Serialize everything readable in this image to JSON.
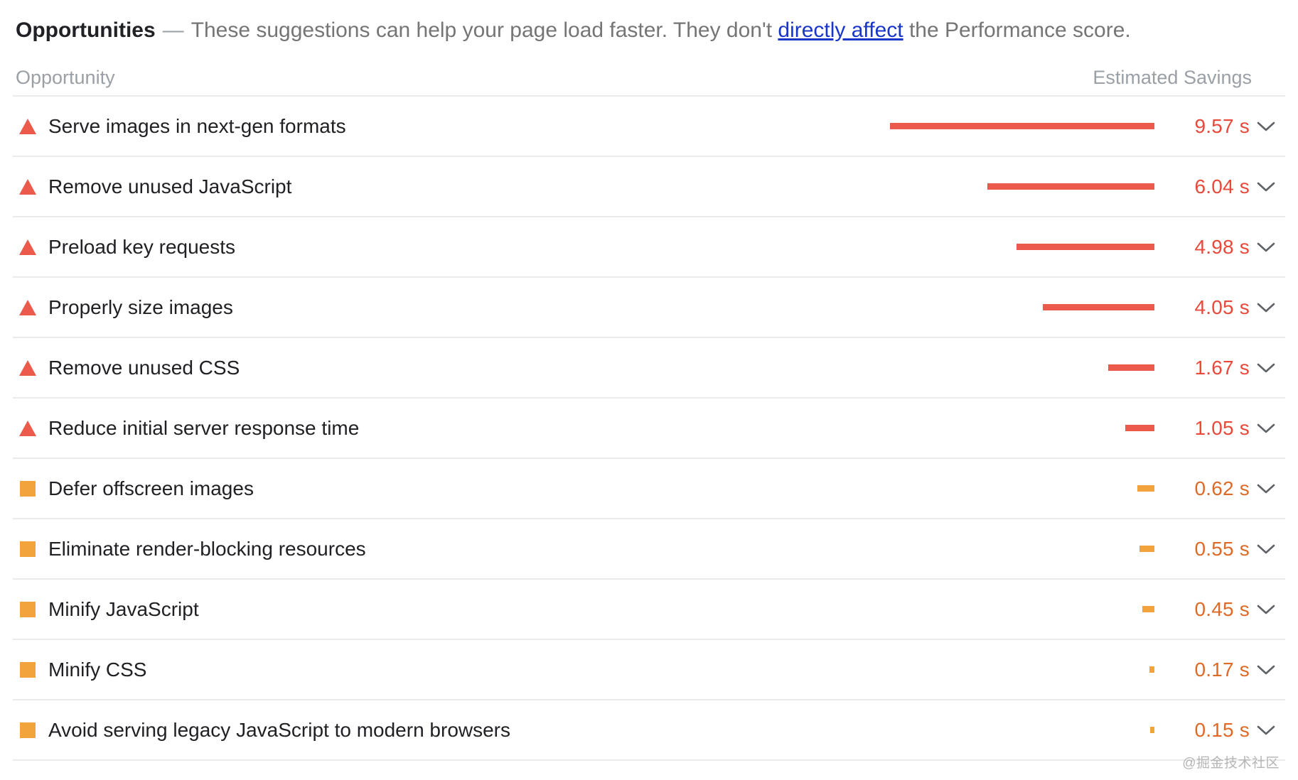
{
  "header": {
    "title": "Opportunities",
    "dash": "—",
    "desc_before": "These suggestions can help your page load faster. They don't",
    "link_text": "directly affect",
    "desc_after": "the Performance score."
  },
  "table": {
    "columns": {
      "opportunity": "Opportunity",
      "savings": "Estimated Savings"
    },
    "rows": [
      {
        "severity": "error",
        "icon": "triangle-warning-icon",
        "label": "Serve images in next-gen formats",
        "savings": "9.57 s",
        "seconds": 9.57,
        "expand_icon": "chevron-down-icon"
      },
      {
        "severity": "error",
        "icon": "triangle-warning-icon",
        "label": "Remove unused JavaScript",
        "savings": "6.04 s",
        "seconds": 6.04,
        "expand_icon": "chevron-down-icon"
      },
      {
        "severity": "error",
        "icon": "triangle-warning-icon",
        "label": "Preload key requests",
        "savings": "4.98 s",
        "seconds": 4.98,
        "expand_icon": "chevron-down-icon"
      },
      {
        "severity": "error",
        "icon": "triangle-warning-icon",
        "label": "Properly size images",
        "savings": "4.05 s",
        "seconds": 4.05,
        "expand_icon": "chevron-down-icon"
      },
      {
        "severity": "error",
        "icon": "triangle-warning-icon",
        "label": "Remove unused CSS",
        "savings": "1.67 s",
        "seconds": 1.67,
        "expand_icon": "chevron-down-icon"
      },
      {
        "severity": "error",
        "icon": "triangle-warning-icon",
        "label": "Reduce initial server response time",
        "savings": "1.05 s",
        "seconds": 1.05,
        "expand_icon": "chevron-down-icon"
      },
      {
        "severity": "average",
        "icon": "square-warning-icon",
        "label": "Defer offscreen images",
        "savings": "0.62 s",
        "seconds": 0.62,
        "expand_icon": "chevron-down-icon"
      },
      {
        "severity": "average",
        "icon": "square-warning-icon",
        "label": "Eliminate render-blocking resources",
        "savings": "0.55 s",
        "seconds": 0.55,
        "expand_icon": "chevron-down-icon"
      },
      {
        "severity": "average",
        "icon": "square-warning-icon",
        "label": "Minify JavaScript",
        "savings": "0.45 s",
        "seconds": 0.45,
        "expand_icon": "chevron-down-icon"
      },
      {
        "severity": "average",
        "icon": "square-warning-icon",
        "label": "Minify CSS",
        "savings": "0.17 s",
        "seconds": 0.17,
        "expand_icon": "chevron-down-icon"
      },
      {
        "severity": "average",
        "icon": "square-warning-icon",
        "label": "Avoid serving legacy JavaScript to modern browsers",
        "savings": "0.15 s",
        "seconds": 0.15,
        "expand_icon": "chevron-down-icon"
      }
    ]
  },
  "chart_data": {
    "type": "bar",
    "title": "Opportunities — Estimated Savings",
    "xlabel": "Estimated Savings (s)",
    "ylabel": "Opportunity",
    "xlim": [
      0,
      9.57
    ],
    "grid": false,
    "legend": null,
    "orientation": "horizontal",
    "categories": [
      "Serve images in next-gen formats",
      "Remove unused JavaScript",
      "Preload key requests",
      "Properly size images",
      "Remove unused CSS",
      "Reduce initial server response time",
      "Defer offscreen images",
      "Eliminate render-blocking resources",
      "Minify JavaScript",
      "Minify CSS",
      "Avoid serving legacy JavaScript to modern browsers"
    ],
    "values": [
      9.57,
      6.04,
      4.98,
      4.05,
      1.67,
      1.05,
      0.62,
      0.55,
      0.45,
      0.17,
      0.15
    ],
    "value_labels": [
      "9.57 s",
      "6.04 s",
      "4.98 s",
      "4.05 s",
      "1.67 s",
      "1.05 s",
      "0.62 s",
      "0.55 s",
      "0.45 s",
      "0.17 s",
      "0.15 s"
    ],
    "bar_colors": [
      "#eb5a4b",
      "#eb5a4b",
      "#eb5a4b",
      "#eb5a4b",
      "#eb5a4b",
      "#eb5a4b",
      "#f2a33c",
      "#f2a33c",
      "#f2a33c",
      "#f2a33c",
      "#f2a33c"
    ]
  },
  "colors": {
    "error": "#eb5a4b",
    "average": "#f2a33c",
    "value_text": "#e8493a",
    "value_text_average": "#dd6a26",
    "link": "#1a36c9",
    "muted": "#9aa0a6",
    "text": "#202124",
    "divider": "#ebebeb"
  },
  "watermark": "@掘金技术社区"
}
